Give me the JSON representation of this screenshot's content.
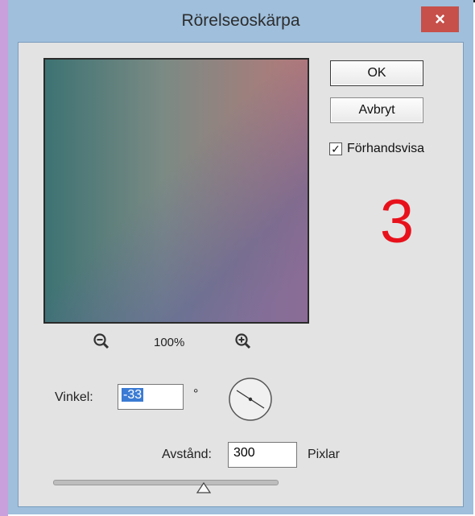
{
  "dialog": {
    "title": "Rörelseoskärpa",
    "close_label": "×",
    "ok_label": "OK",
    "cancel_label": "Avbryt",
    "preview_label": "Förhandsvisa",
    "preview_checked": "✓",
    "zoom_level": "100%",
    "step_number": "3",
    "angle": {
      "label": "Vinkel:",
      "value": "-33",
      "unit": "°"
    },
    "distance": {
      "label": "Avstånd:",
      "value": "300",
      "unit": "Pixlar"
    },
    "colors": {
      "title_bar": "#9fbfdc",
      "close_button": "#c7504a",
      "step_number": "#e8111b"
    },
    "icons": {
      "zoom_out": "zoom-out-icon",
      "zoom_in": "zoom-in-icon",
      "angle_dial": "angle-dial-icon"
    }
  }
}
